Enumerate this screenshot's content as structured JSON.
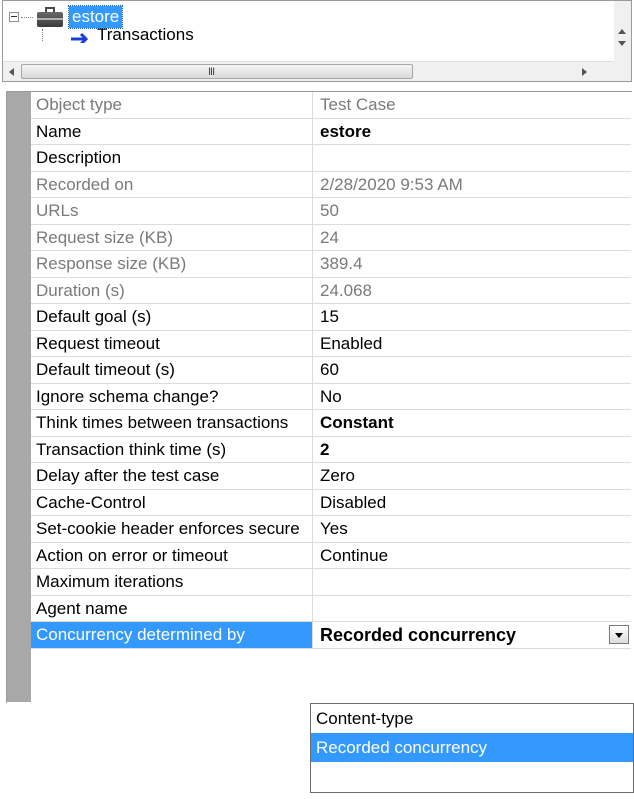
{
  "tree": {
    "root_label": "estore",
    "child_label": "Transactions",
    "hscroll_grip": "III"
  },
  "properties": [
    {
      "name": "Object type",
      "value": "Test Case",
      "readonly": true,
      "bold": false
    },
    {
      "name": "Name",
      "value": "estore",
      "readonly": false,
      "bold": true
    },
    {
      "name": "Description",
      "value": "",
      "readonly": false,
      "bold": false
    },
    {
      "name": "Recorded on",
      "value": "2/28/2020 9:53 AM",
      "readonly": true,
      "bold": false
    },
    {
      "name": "URLs",
      "value": "50",
      "readonly": true,
      "bold": false
    },
    {
      "name": "Request size (KB)",
      "value": "24",
      "readonly": true,
      "bold": false
    },
    {
      "name": "Response size (KB)",
      "value": "389.4",
      "readonly": true,
      "bold": false
    },
    {
      "name": "Duration (s)",
      "value": "24.068",
      "readonly": true,
      "bold": false
    },
    {
      "name": "Default goal (s)",
      "value": "15",
      "readonly": false,
      "bold": false
    },
    {
      "name": "Request timeout",
      "value": "Enabled",
      "readonly": false,
      "bold": false
    },
    {
      "name": "Default timeout (s)",
      "value": "60",
      "readonly": false,
      "bold": false
    },
    {
      "name": "Ignore schema change?",
      "value": "No",
      "readonly": false,
      "bold": false
    },
    {
      "name": "Think times between transactions",
      "value": "Constant",
      "readonly": false,
      "bold": true
    },
    {
      "name": "Transaction think time (s)",
      "value": "2",
      "readonly": false,
      "bold": true
    },
    {
      "name": "Delay after the test case",
      "value": "Zero",
      "readonly": false,
      "bold": false
    },
    {
      "name": "Cache-Control",
      "value": "Disabled",
      "readonly": false,
      "bold": false
    },
    {
      "name": "Set-cookie header enforces secure",
      "value": "Yes",
      "readonly": false,
      "bold": false
    },
    {
      "name": "Action on error or timeout",
      "value": "Continue",
      "readonly": false,
      "bold": false
    },
    {
      "name": "Maximum iterations",
      "value": "",
      "readonly": false,
      "bold": false
    },
    {
      "name": "Agent name",
      "value": "",
      "readonly": false,
      "bold": false
    },
    {
      "name": "Concurrency determined by",
      "value": "Recorded concurrency",
      "readonly": false,
      "bold": true,
      "selected": true
    }
  ],
  "dropdown": {
    "options": [
      "Content-type",
      "Recorded concurrency"
    ],
    "selected_index": 1
  },
  "colors": {
    "selection": "#3399ff",
    "gutter": "#a8a8a8",
    "readonly_text": "#7a7a7a"
  }
}
